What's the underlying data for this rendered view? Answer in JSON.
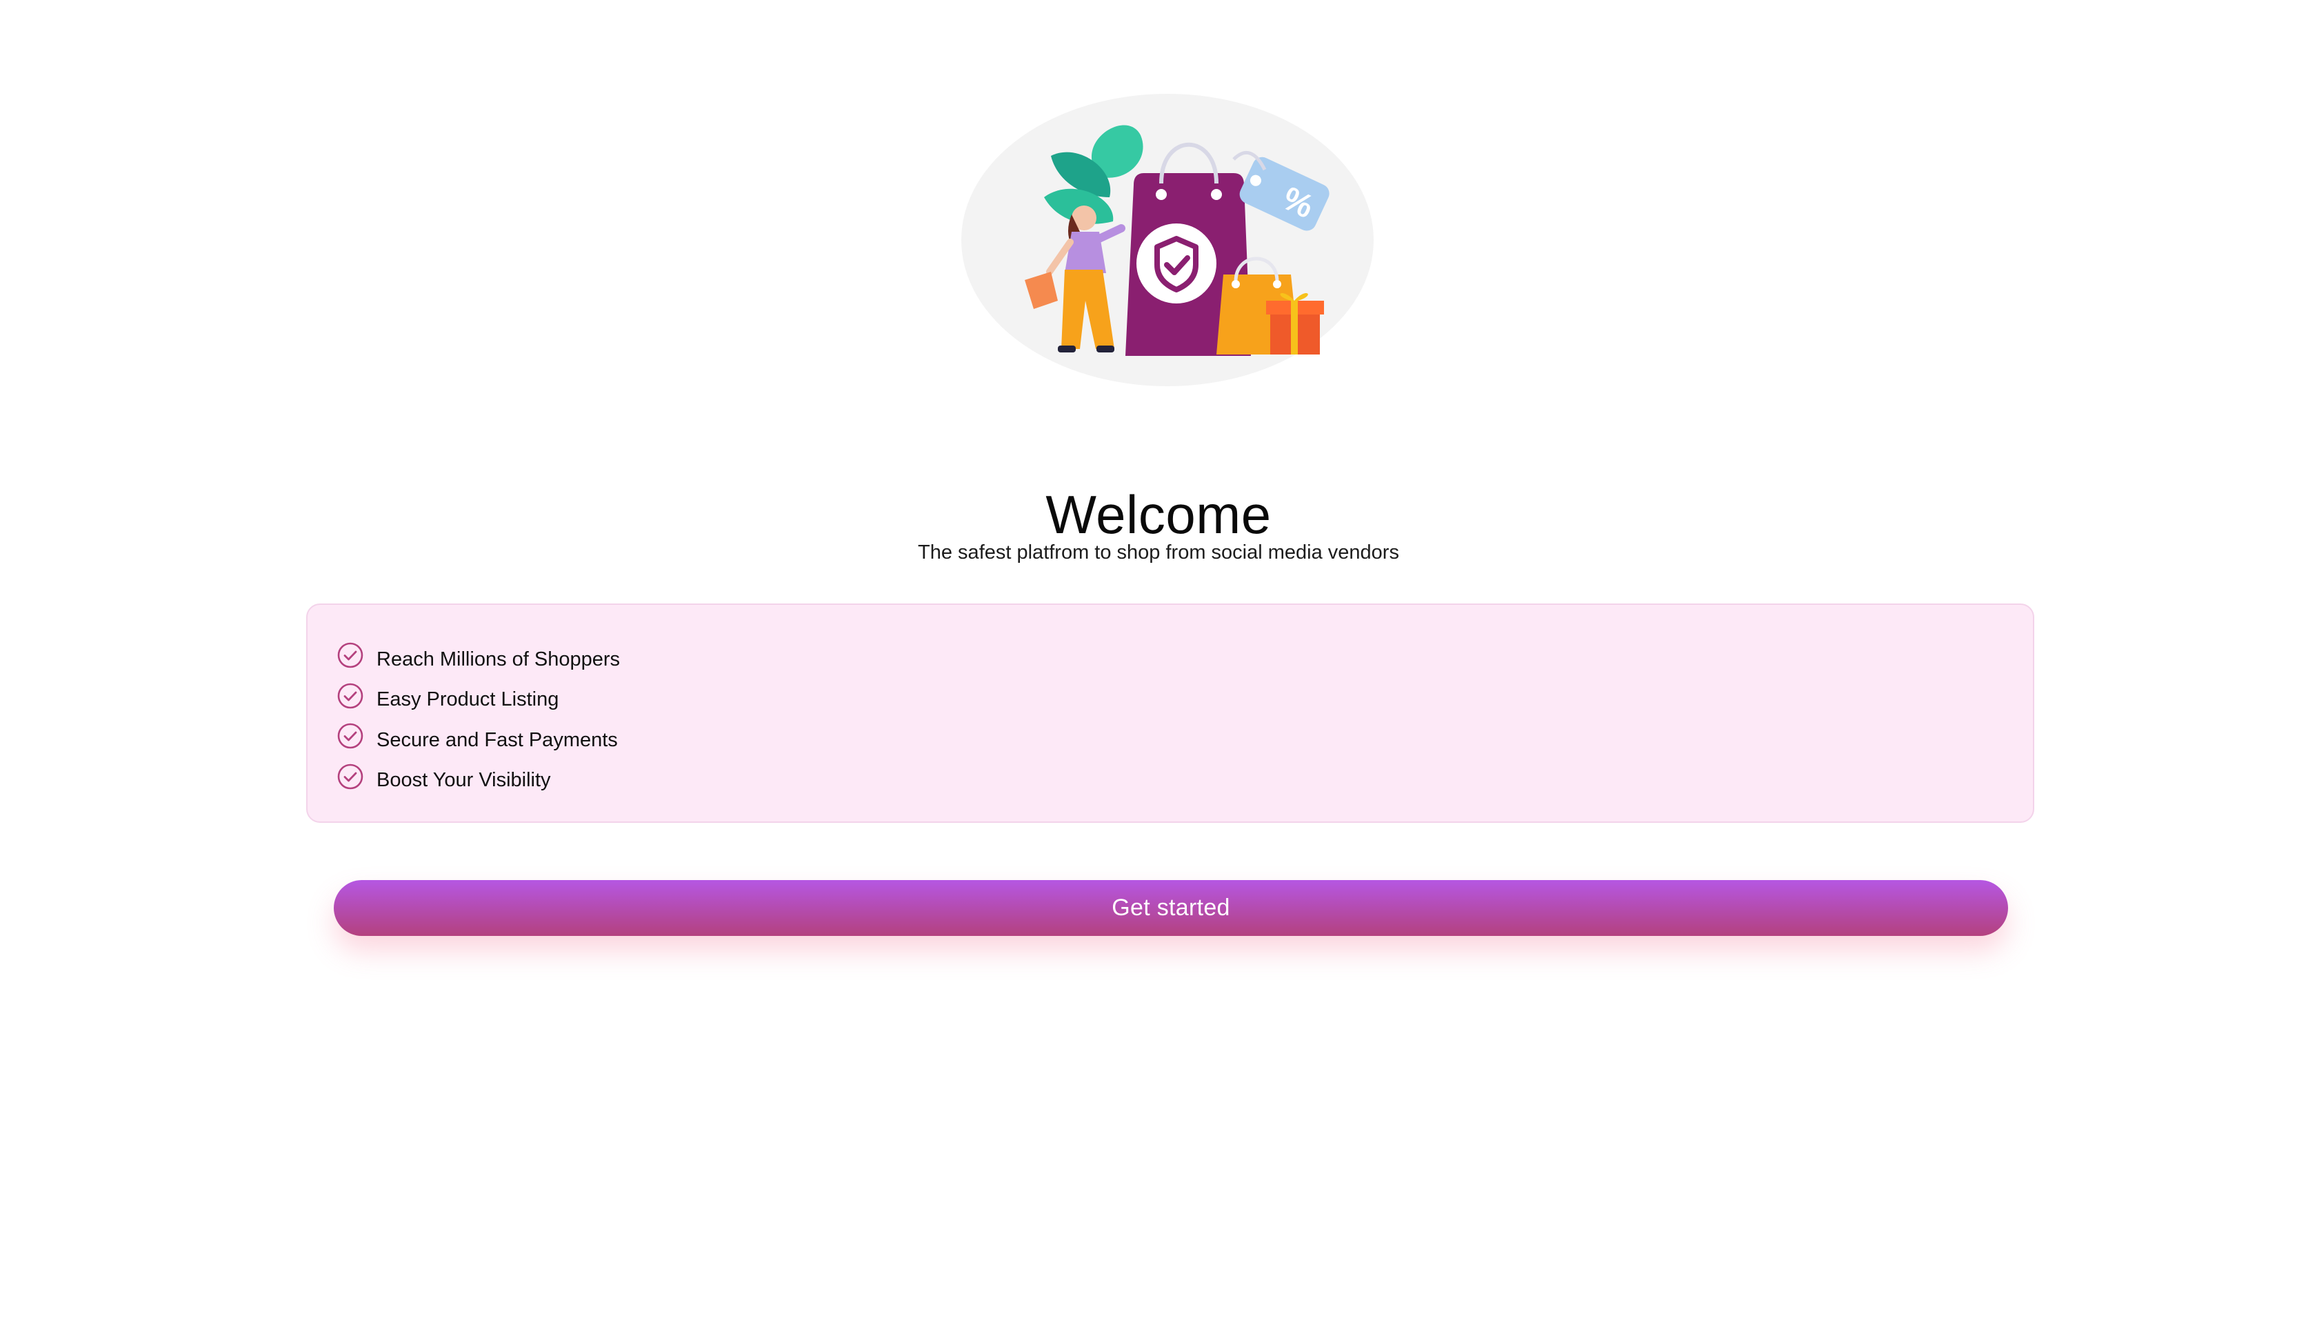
{
  "hero": {
    "illustration": "shopping-illustration",
    "badge_icon": "shield-check-icon",
    "tag_text": "%"
  },
  "header": {
    "title": "Welcome",
    "subtitle": "The safest platfrom to shop from social media vendors"
  },
  "features": {
    "icon": "check-circle-icon",
    "items": [
      {
        "label": "Reach Millions of Shoppers"
      },
      {
        "label": "Easy Product Listing"
      },
      {
        "label": "Secure and Fast Payments"
      },
      {
        "label": "Boost Your Visibility"
      }
    ]
  },
  "cta": {
    "label": "Get started"
  },
  "colors": {
    "accent_start": "#b557e3",
    "accent_end": "#b4417e",
    "feature_bg": "#fde9f7",
    "check": "#b4417e"
  }
}
